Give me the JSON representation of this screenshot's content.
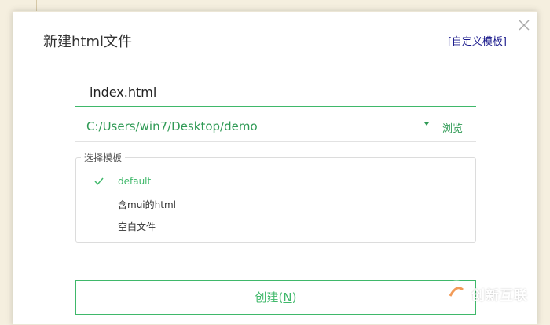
{
  "dialog": {
    "title": "新建html文件",
    "template_link": {
      "open_bracket": "[",
      "label": "自定义模板",
      "close_bracket": "]"
    }
  },
  "filename": {
    "value": "index.html"
  },
  "location": {
    "path": "C:/Users/win7/Desktop/demo",
    "browse_label": "浏览"
  },
  "templates": {
    "legend": "选择模板",
    "items": [
      {
        "label": "default",
        "selected": true
      },
      {
        "label": "含mui的html",
        "selected": false
      },
      {
        "label": "空白文件",
        "selected": false
      }
    ]
  },
  "create_button": {
    "label": "创建(",
    "mnemonic": "N",
    "suffix": ")"
  },
  "watermark": {
    "text": "创新互联"
  },
  "colors": {
    "accent": "#3fb86a",
    "accent_text": "#2f9a55",
    "link": "#1a1a8c",
    "background": "#f5efdf"
  },
  "icons": {
    "close": "close-icon",
    "dropdown": "caret-down-icon",
    "check": "check-icon"
  }
}
